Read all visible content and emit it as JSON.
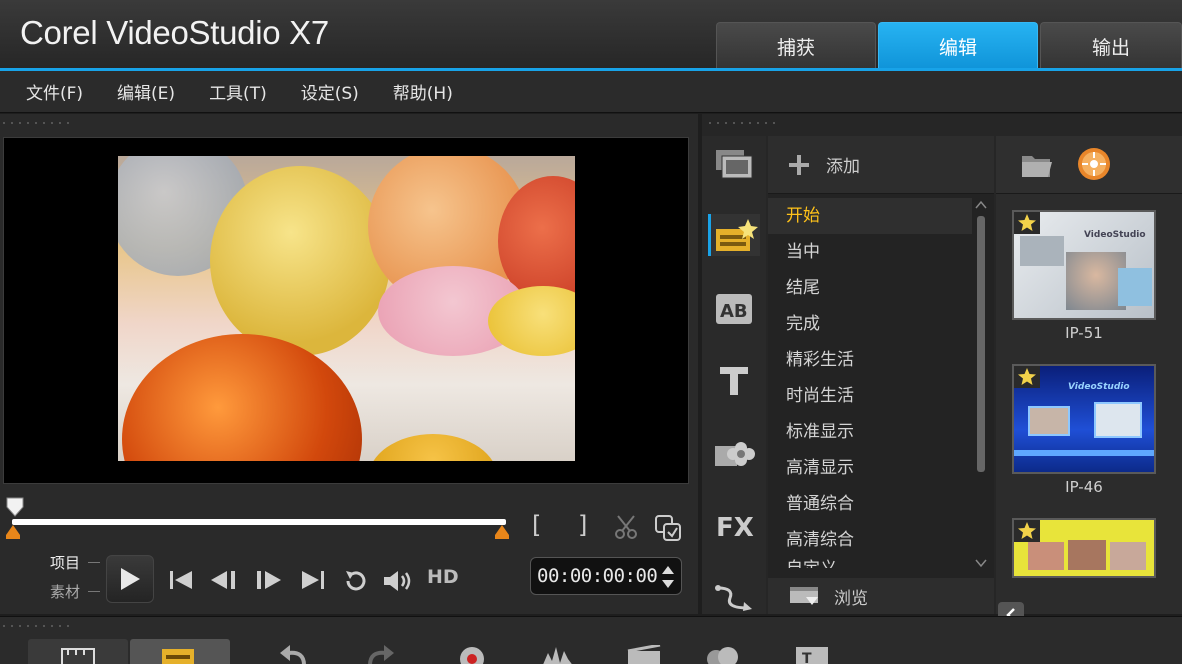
{
  "app": {
    "title": "Corel VideoStudio X7"
  },
  "mode_tabs": [
    {
      "label": "捕获",
      "active": false
    },
    {
      "label": "编辑",
      "active": true
    },
    {
      "label": "输出",
      "active": false
    }
  ],
  "menu": [
    "文件(F)",
    "编辑(E)",
    "工具(T)",
    "设定(S)",
    "帮助(H)"
  ],
  "player": {
    "mode_project": "项目",
    "mode_clip": "素材",
    "hd_label": "HD",
    "timecode": "00:00:00:00",
    "mark_in": "[",
    "mark_out": "]"
  },
  "library": {
    "add_label": "添加",
    "browse_label": "浏览",
    "categories": [
      {
        "name": "media-icon",
        "active": false
      },
      {
        "name": "instant-project-icon",
        "active": true
      },
      {
        "name": "transition-icon",
        "active": false
      },
      {
        "name": "title-icon",
        "active": false
      },
      {
        "name": "graphic-icon",
        "active": false
      },
      {
        "name": "fx-icon",
        "active": false
      },
      {
        "name": "path-icon",
        "active": false
      }
    ],
    "items": [
      {
        "label": "开始",
        "selected": true
      },
      {
        "label": "当中",
        "selected": false
      },
      {
        "label": "结尾",
        "selected": false
      },
      {
        "label": "完成",
        "selected": false
      },
      {
        "label": "精彩生活",
        "selected": false
      },
      {
        "label": "时尚生活",
        "selected": false
      },
      {
        "label": "标准显示",
        "selected": false
      },
      {
        "label": "高清显示",
        "selected": false
      },
      {
        "label": "普通综合",
        "selected": false
      },
      {
        "label": "高清综合",
        "selected": false
      },
      {
        "label": "自定义",
        "selected": false
      }
    ],
    "thumbnails": [
      {
        "label": "IP-51",
        "brand_text": "VideoStudio"
      },
      {
        "label": "IP-46",
        "brand_text": "VideoStudio"
      },
      {
        "label": "",
        "brand_text": ""
      }
    ]
  },
  "colors": {
    "accent": "#18a3e8",
    "selected_item": "#ffc21a",
    "trim_marker": "#e8861a"
  }
}
